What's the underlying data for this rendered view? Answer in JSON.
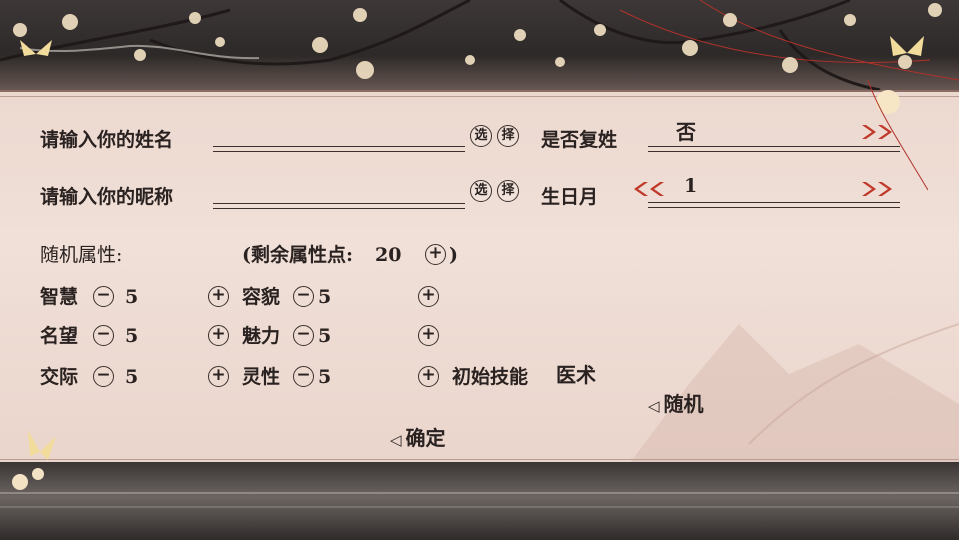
{
  "form": {
    "name_label": "请输入你的姓名",
    "nickname_label": "请输入你的昵称",
    "select_char1": "选",
    "select_char2": "择",
    "compound_surname_label": "是否复姓",
    "compound_surname_value": "否",
    "birth_month_label": "生日月",
    "birth_month_value": "1"
  },
  "attributes": {
    "random_label": "随机属性:",
    "remaining_prefix": "(剩余属性点:",
    "remaining_value": "20",
    "remaining_suffix": ")",
    "items": [
      {
        "name": "智慧",
        "value": "5"
      },
      {
        "name": "容貌",
        "value": "5"
      },
      {
        "name": "名望",
        "value": "5"
      },
      {
        "name": "魅力",
        "value": "5"
      },
      {
        "name": "交际",
        "value": "5"
      },
      {
        "name": "灵性",
        "value": "5"
      }
    ],
    "initial_skill_label": "初始技能",
    "initial_skill_value": "医术"
  },
  "buttons": {
    "random": "随机",
    "confirm": "确定"
  },
  "colors": {
    "panel": "#ecd8cf",
    "text": "#2a2220",
    "arrow_red": "#c0392b",
    "border": "#8c6d63"
  },
  "icons": [
    "plus-icon",
    "minus-icon",
    "double-chevron-right-icon",
    "double-chevron-left-icon",
    "triangle-left-icon",
    "butterfly-icon",
    "plum-blossom-icon"
  ]
}
